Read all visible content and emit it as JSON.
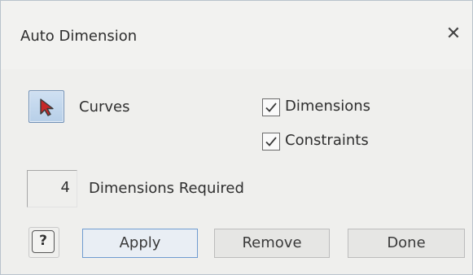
{
  "dialog": {
    "title": "Auto Dimension",
    "close_icon": "close-icon"
  },
  "selection": {
    "curves_icon": "select-arrow-icon",
    "curves_label": "Curves"
  },
  "options": {
    "dimensions_label": "Dimensions",
    "dimensions_checked": true,
    "constraints_label": "Constraints",
    "constraints_checked": true
  },
  "status": {
    "count": "4",
    "required_label": "Dimensions Required"
  },
  "buttons": {
    "help_icon": "help-icon",
    "help_glyph": "?",
    "apply": "Apply",
    "remove": "Remove",
    "done": "Done"
  },
  "colors": {
    "accent_border": "#6f9bd0",
    "arrow_fill": "#c62828"
  }
}
